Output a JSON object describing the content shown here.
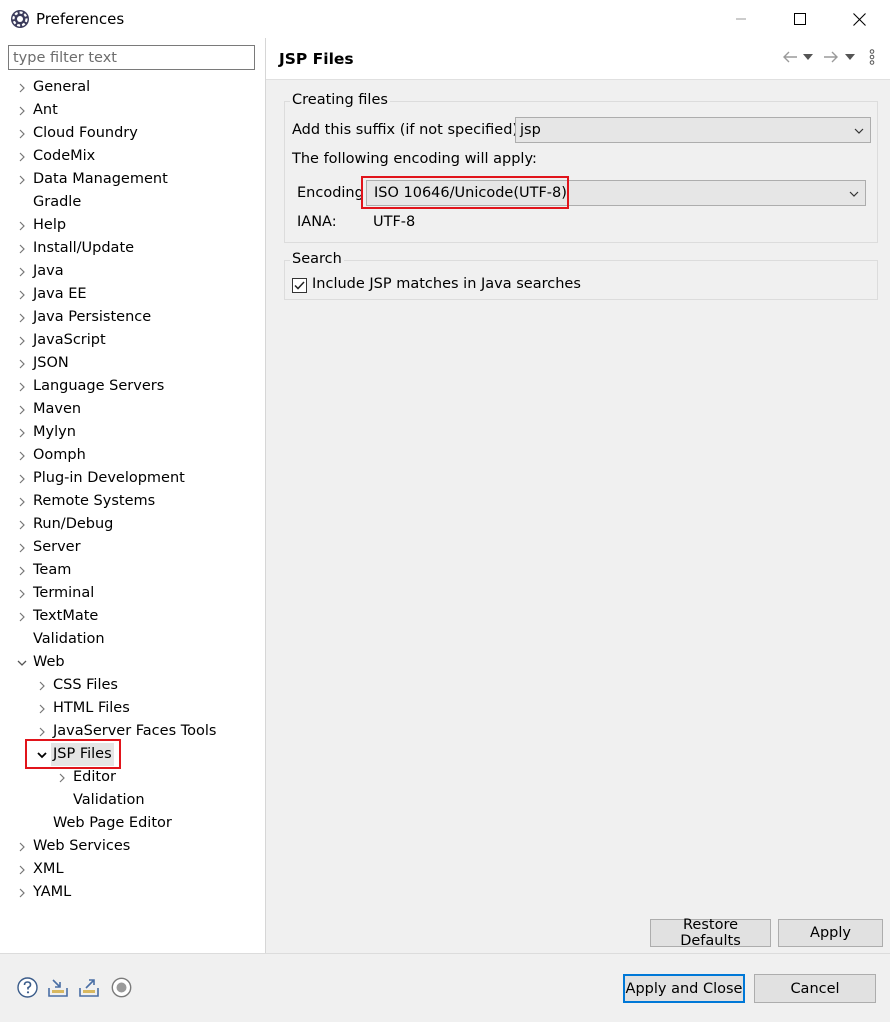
{
  "window": {
    "title": "Preferences",
    "app_icon": "eclipse-gear-icon",
    "controls": [
      "minimize-icon",
      "maximize-icon",
      "close-icon"
    ]
  },
  "filter": {
    "placeholder": "type filter text",
    "value": ""
  },
  "tree": {
    "items": [
      {
        "label": "General",
        "expandable": true,
        "expanded": false,
        "depth": 0
      },
      {
        "label": "Ant",
        "expandable": true,
        "expanded": false,
        "depth": 0
      },
      {
        "label": "Cloud Foundry",
        "expandable": true,
        "expanded": false,
        "depth": 0
      },
      {
        "label": "CodeMix",
        "expandable": true,
        "expanded": false,
        "depth": 0
      },
      {
        "label": "Data Management",
        "expandable": true,
        "expanded": false,
        "depth": 0
      },
      {
        "label": "Gradle",
        "expandable": false,
        "expanded": false,
        "depth": 0
      },
      {
        "label": "Help",
        "expandable": true,
        "expanded": false,
        "depth": 0
      },
      {
        "label": "Install/Update",
        "expandable": true,
        "expanded": false,
        "depth": 0
      },
      {
        "label": "Java",
        "expandable": true,
        "expanded": false,
        "depth": 0
      },
      {
        "label": "Java EE",
        "expandable": true,
        "expanded": false,
        "depth": 0
      },
      {
        "label": "Java Persistence",
        "expandable": true,
        "expanded": false,
        "depth": 0
      },
      {
        "label": "JavaScript",
        "expandable": true,
        "expanded": false,
        "depth": 0
      },
      {
        "label": "JSON",
        "expandable": true,
        "expanded": false,
        "depth": 0
      },
      {
        "label": "Language Servers",
        "expandable": true,
        "expanded": false,
        "depth": 0
      },
      {
        "label": "Maven",
        "expandable": true,
        "expanded": false,
        "depth": 0
      },
      {
        "label": "Mylyn",
        "expandable": true,
        "expanded": false,
        "depth": 0
      },
      {
        "label": "Oomph",
        "expandable": true,
        "expanded": false,
        "depth": 0
      },
      {
        "label": "Plug-in Development",
        "expandable": true,
        "expanded": false,
        "depth": 0
      },
      {
        "label": "Remote Systems",
        "expandable": true,
        "expanded": false,
        "depth": 0
      },
      {
        "label": "Run/Debug",
        "expandable": true,
        "expanded": false,
        "depth": 0
      },
      {
        "label": "Server",
        "expandable": true,
        "expanded": false,
        "depth": 0
      },
      {
        "label": "Team",
        "expandable": true,
        "expanded": false,
        "depth": 0
      },
      {
        "label": "Terminal",
        "expandable": true,
        "expanded": false,
        "depth": 0
      },
      {
        "label": "TextMate",
        "expandable": true,
        "expanded": false,
        "depth": 0
      },
      {
        "label": "Validation",
        "expandable": false,
        "expanded": false,
        "depth": 0
      },
      {
        "label": "Web",
        "expandable": true,
        "expanded": true,
        "depth": 0
      },
      {
        "label": "CSS Files",
        "expandable": true,
        "expanded": false,
        "depth": 1
      },
      {
        "label": "HTML Files",
        "expandable": true,
        "expanded": false,
        "depth": 1
      },
      {
        "label": "JavaServer Faces Tools",
        "expandable": true,
        "expanded": false,
        "depth": 1
      },
      {
        "label": "JSP Files",
        "expandable": true,
        "expanded": true,
        "depth": 1,
        "selected": true
      },
      {
        "label": "Editor",
        "expandable": true,
        "expanded": false,
        "depth": 2
      },
      {
        "label": "Validation",
        "expandable": false,
        "expanded": false,
        "depth": 2
      },
      {
        "label": "Web Page Editor",
        "expandable": false,
        "expanded": false,
        "depth": 1
      },
      {
        "label": "Web Services",
        "expandable": true,
        "expanded": false,
        "depth": 0
      },
      {
        "label": "XML",
        "expandable": true,
        "expanded": false,
        "depth": 0
      },
      {
        "label": "YAML",
        "expandable": true,
        "expanded": false,
        "depth": 0
      }
    ]
  },
  "page": {
    "title": "JSP Files",
    "header_icons": [
      "back-arrow-icon",
      "back-menu-icon",
      "forward-arrow-icon",
      "forward-menu-icon",
      "view-menu-icon"
    ],
    "creating_files": {
      "group_title": "Creating files",
      "suffix_label": "Add this suffix (if not specified):",
      "suffix_value": "jsp",
      "encoding_note": "The following encoding will apply:",
      "encoding_label": "Encoding",
      "encoding_value": "ISO 10646/Unicode(UTF-8)",
      "iana_label": "IANA:",
      "iana_value": "UTF-8"
    },
    "search": {
      "group_title": "Search",
      "include_label": "Include JSP matches in Java searches",
      "include_checked": true
    },
    "restore_defaults_label": "Restore Defaults",
    "apply_label": "Apply"
  },
  "footer": {
    "icons": [
      "help-icon",
      "import-icon",
      "export-icon",
      "record-icon"
    ],
    "apply_close_label": "Apply and Close",
    "cancel_label": "Cancel"
  },
  "colors": {
    "highlight": "#e1141b",
    "default_button_border": "#0078d7",
    "panel_bg": "#f0f0f0"
  }
}
